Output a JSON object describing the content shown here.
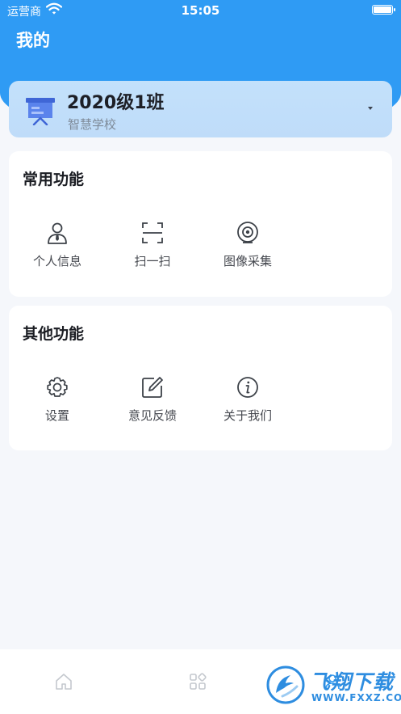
{
  "status_bar": {
    "carrier": "运营商",
    "time": "15:05"
  },
  "header": {
    "title": "我的"
  },
  "class_card": {
    "class_name": "2020级1班",
    "school_name": "智慧学校"
  },
  "sections": [
    {
      "title": "常用功能",
      "items": [
        {
          "label": "个人信息",
          "icon": "user-icon"
        },
        {
          "label": "扫一扫",
          "icon": "scan-icon"
        },
        {
          "label": "图像采集",
          "icon": "camera-icon"
        }
      ]
    },
    {
      "title": "其他功能",
      "items": [
        {
          "label": "设置",
          "icon": "gear-icon"
        },
        {
          "label": "意见反馈",
          "icon": "edit-icon"
        },
        {
          "label": "关于我们",
          "icon": "info-icon"
        }
      ]
    }
  ],
  "tab_bar": {
    "tabs": [
      {
        "icon": "home-icon"
      },
      {
        "icon": "grid-icon"
      },
      {
        "icon": "profile-icon"
      }
    ]
  },
  "watermark": {
    "text": "飞翔下载",
    "url": "WWW.FXXZ.COM"
  },
  "colors": {
    "primary": "#2f9bf4",
    "card_blue": "#c3e1fb",
    "background": "#f5f7fb",
    "watermark": "#2e8de0"
  }
}
